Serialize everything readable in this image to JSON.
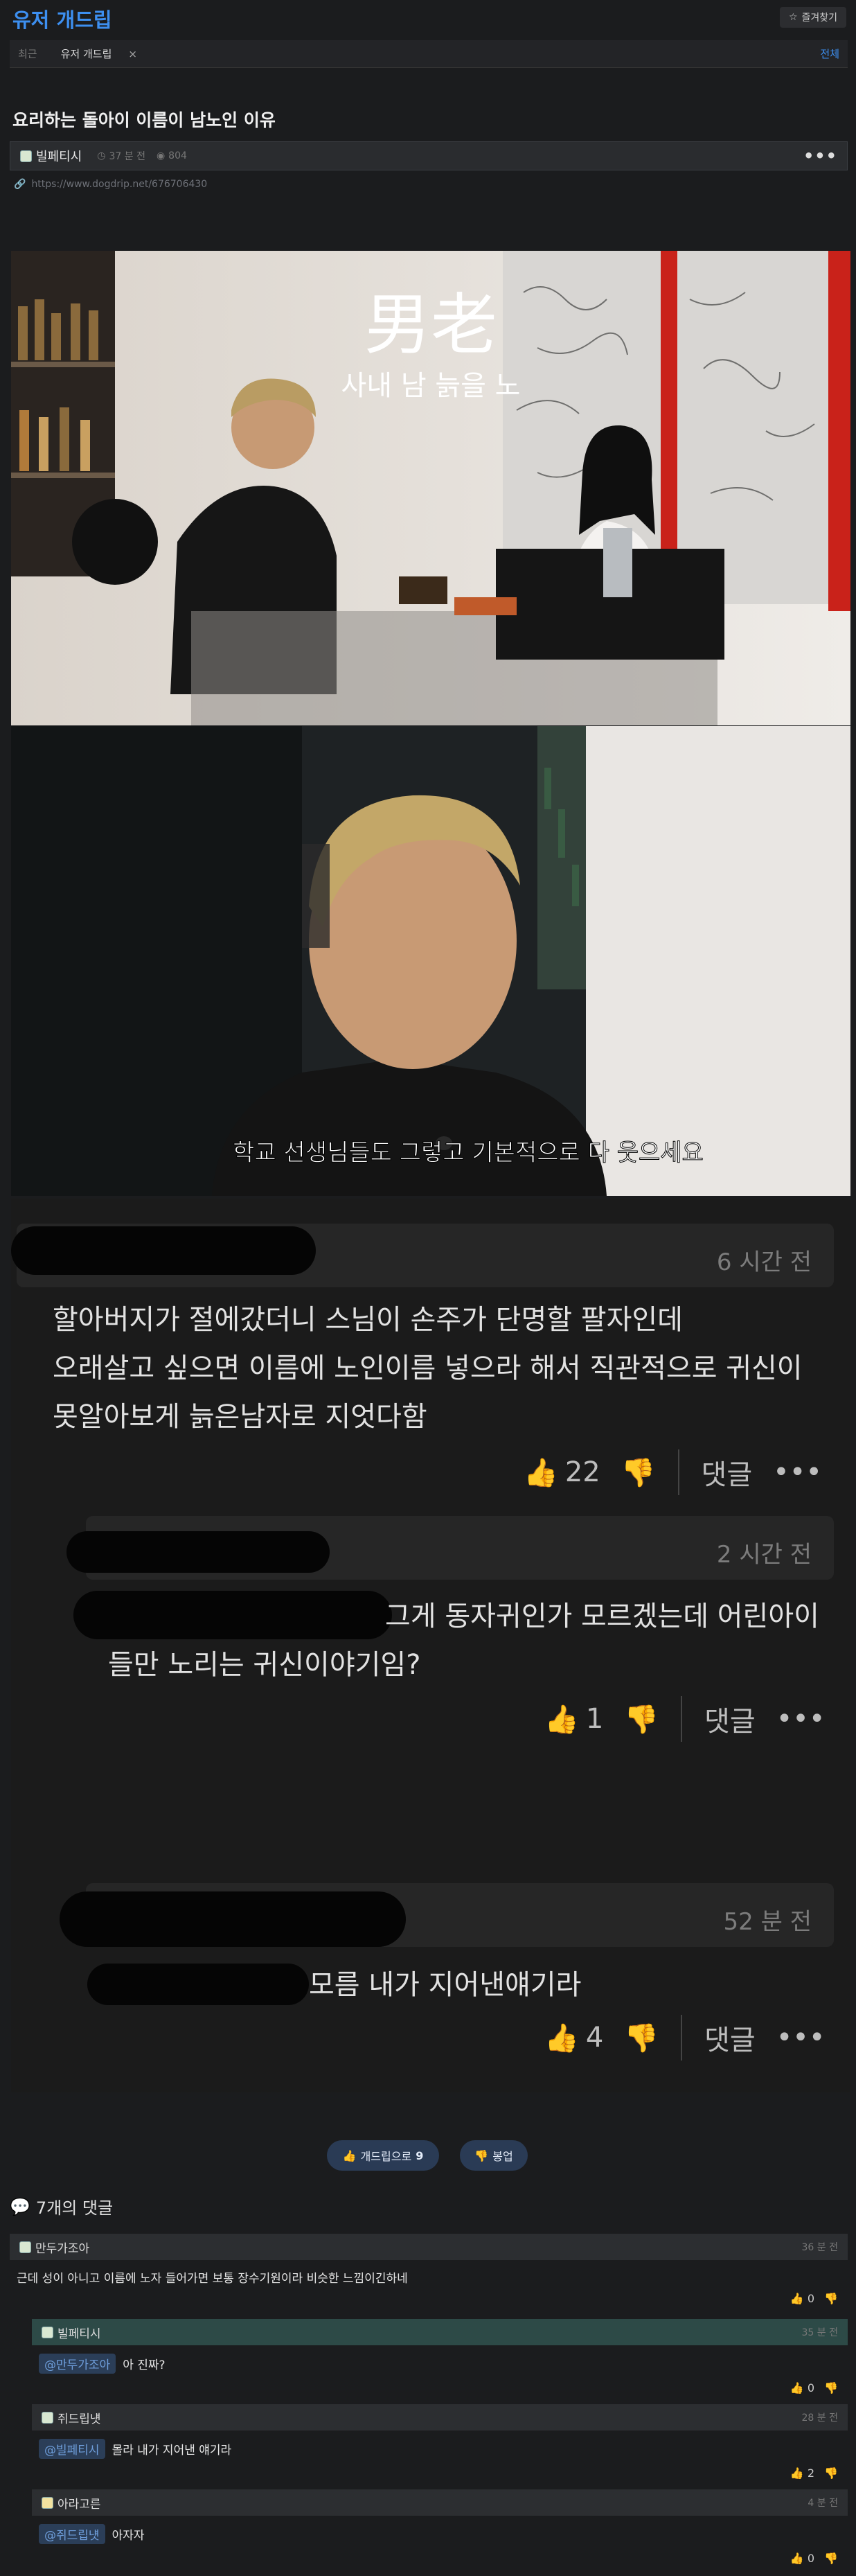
{
  "board": {
    "title": "유저 개드립",
    "bookmark_label": "즐겨찾기"
  },
  "recent": {
    "label": "최근",
    "chip": "유저 개드립",
    "close": "×",
    "all": "전체"
  },
  "post": {
    "title": "요리하는 돌아이 이름이 남노인 이유",
    "author": "빌페티시",
    "time": "37 분 전",
    "views": "804",
    "more": "•••",
    "link": "https://www.dogdrip.net/676706430"
  },
  "image1": {
    "hanja": "男老",
    "caption": "사내 남 늙을 노"
  },
  "image2": {
    "subtitle": "학교 선생님들도 그렇고 기본적으로 다 웃으세요"
  },
  "shot_comments": [
    {
      "time": "6 시간 전",
      "lines": [
        "할아버지가 절에갔더니 스님이 손주가 단명할 팔자인데",
        "오래살고 싶으면 이름에 노인이름 넣으라 해서 직관적으로 귀신이",
        "못알아보게 늙은남자로 지엇다함"
      ],
      "likes": "22",
      "reply": "댓글",
      "more": "•••"
    },
    {
      "time": "2 시간 전",
      "lines": [
        "그게 동자귀인가 모르겠는데 어린아이",
        "들만 노리는 귀신이야기임?"
      ],
      "likes": "1",
      "reply": "댓글",
      "more": "•••"
    },
    {
      "time": "52 분 전",
      "lines": [
        "모름 내가 지어낸얘기라"
      ],
      "likes": "4",
      "reply": "댓글",
      "more": "•••"
    }
  ],
  "actions": {
    "dogdrip_label": "개드립으로",
    "dogdrip_count": "9",
    "report_label": "봉업"
  },
  "comments_header": "7개의 댓글",
  "comments": [
    {
      "author": "만두가조아",
      "time": "36 분 전",
      "mention": "",
      "text": "근데 성이 아니고 이름에 노자 들어가면 보통 장수기원이라 비슷한 느낌이긴하네",
      "likes": "0"
    },
    {
      "author": "빌페티시",
      "time": "35 분 전",
      "mention": "@만두가조아",
      "text": "아 진짜?",
      "likes": "0"
    },
    {
      "author": "쥐드립냿",
      "time": "28 분 전",
      "mention": "@빌페티시",
      "text": "몰라 내가 지어낸 얘기라",
      "likes": "2"
    },
    {
      "author": "아라고른",
      "time": "4 분 전",
      "mention": "@쥐드립냿",
      "text": "아자자",
      "likes": "0"
    }
  ]
}
